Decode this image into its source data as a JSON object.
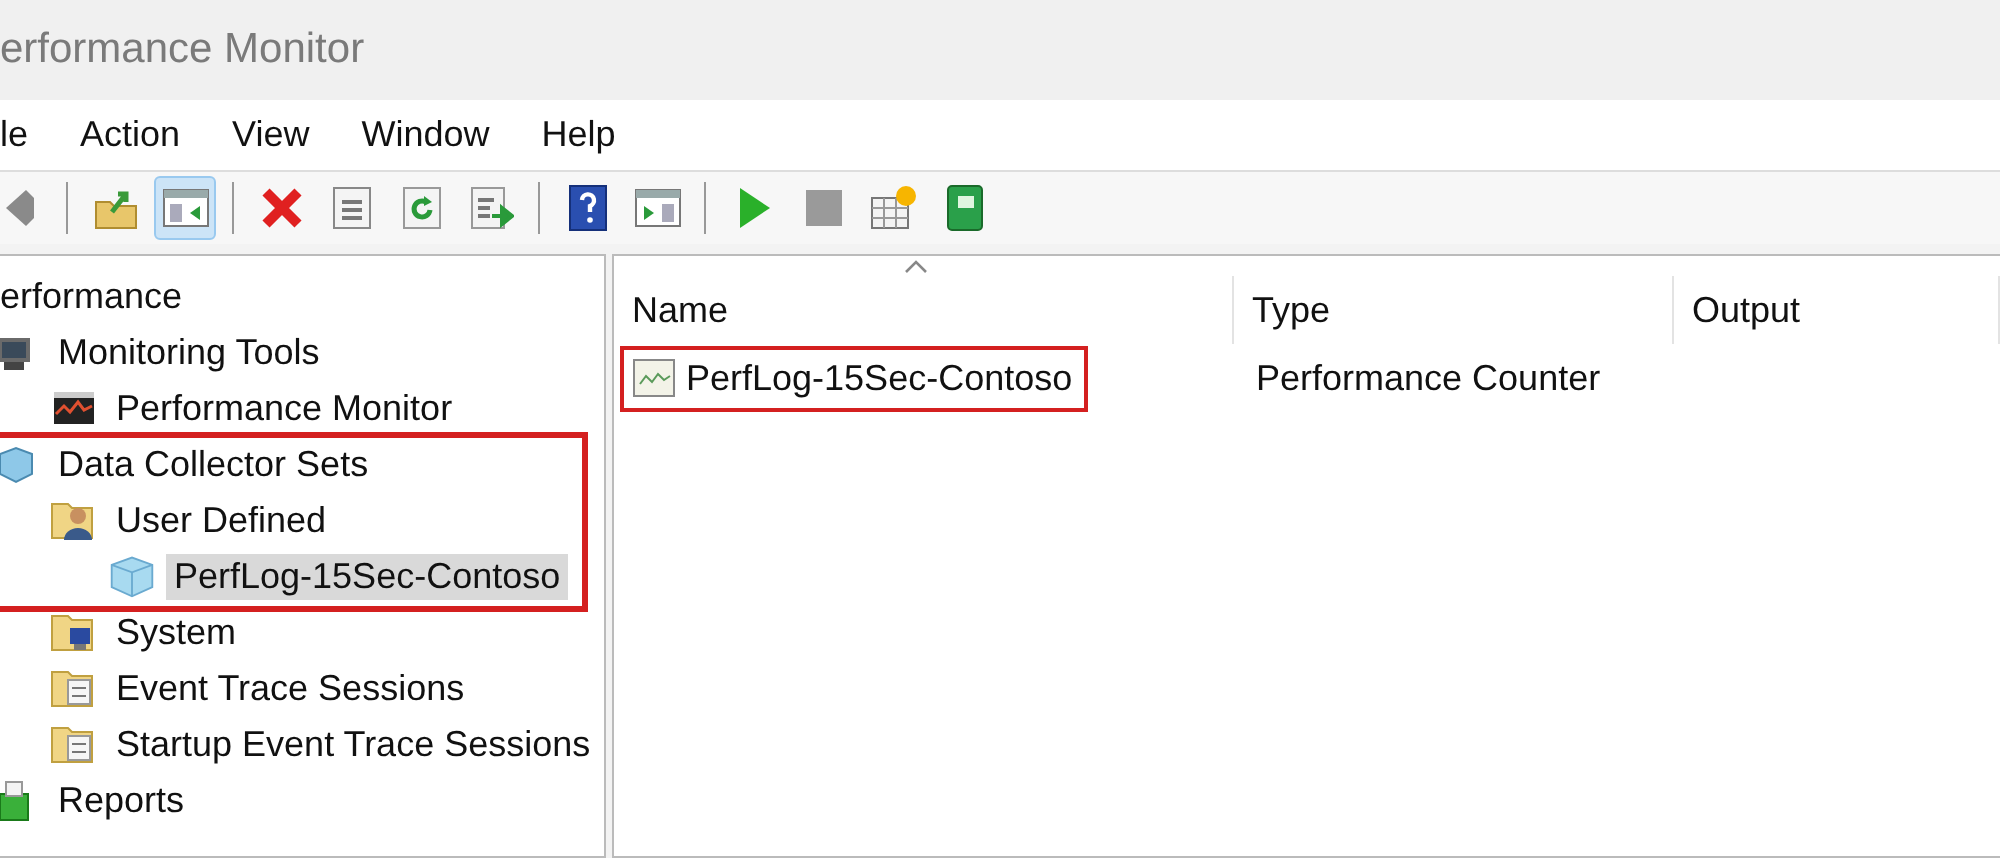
{
  "window": {
    "title": "erformance Monitor"
  },
  "menu": [
    "le",
    "Action",
    "View",
    "Window",
    "Help"
  ],
  "toolbar": [
    {
      "kind": "back",
      "pressed": false
    },
    {
      "kind": "sep"
    },
    {
      "kind": "up-folder",
      "pressed": false
    },
    {
      "kind": "tree-toggle",
      "pressed": true
    },
    {
      "kind": "sep"
    },
    {
      "kind": "delete",
      "pressed": false
    },
    {
      "kind": "properties",
      "pressed": false
    },
    {
      "kind": "refresh",
      "pressed": false
    },
    {
      "kind": "export",
      "pressed": false
    },
    {
      "kind": "sep"
    },
    {
      "kind": "help",
      "pressed": false
    },
    {
      "kind": "console",
      "pressed": false
    },
    {
      "kind": "sep"
    },
    {
      "kind": "play",
      "pressed": false
    },
    {
      "kind": "stop",
      "pressed": false
    },
    {
      "kind": "new-set",
      "pressed": false
    },
    {
      "kind": "notebook",
      "pressed": false
    }
  ],
  "tree": [
    {
      "label": "erformance",
      "selected": false,
      "highlighted": false,
      "children": [
        {
          "label": "Monitoring Tools",
          "kind": "tools",
          "selected": false,
          "highlighted": false,
          "children": [
            {
              "label": "Performance Monitor",
              "kind": "monitor",
              "selected": false,
              "highlighted": false
            }
          ]
        },
        {
          "label": "Data Collector Sets",
          "kind": "dcs",
          "selected": false,
          "highlighted": true,
          "children": [
            {
              "label": "User Defined",
              "kind": "user",
              "selected": false,
              "highlighted": true,
              "children": [
                {
                  "label": "PerfLog-15Sec-Contoso",
                  "kind": "set",
                  "selected": true,
                  "highlighted": true
                }
              ]
            },
            {
              "label": "System",
              "kind": "system",
              "selected": false,
              "highlighted": false
            },
            {
              "label": "Event Trace Sessions",
              "kind": "trace",
              "selected": false,
              "highlighted": false
            },
            {
              "label": "Startup Event Trace Sessions",
              "kind": "trace",
              "selected": false,
              "highlighted": false
            }
          ]
        },
        {
          "label": "Reports",
          "kind": "reports",
          "selected": false,
          "highlighted": false
        }
      ]
    }
  ],
  "list": {
    "columns": [
      {
        "label": "Name",
        "sorted": true
      },
      {
        "label": "Type",
        "sorted": false
      },
      {
        "label": "Output",
        "sorted": false
      }
    ],
    "rows": [
      {
        "cells": [
          "PerfLog-15Sec-Contoso",
          "Performance Counter"
        ],
        "selected": false,
        "highlighted": true
      }
    ]
  }
}
